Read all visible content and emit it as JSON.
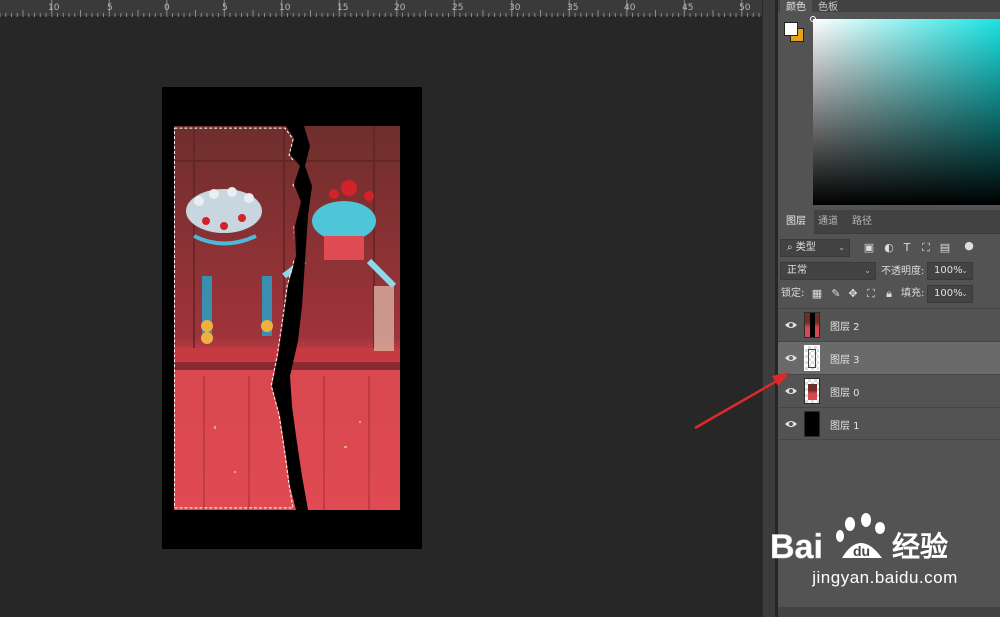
{
  "ruler": {
    "labels": [
      "10",
      "5",
      "0",
      "5",
      "10",
      "15",
      "20",
      "25",
      "30",
      "35",
      "40",
      "45",
      "50"
    ]
  },
  "color_panel": {
    "tabs": [
      "颜色",
      "色板"
    ],
    "foreground": "#ffffff",
    "background": "#e6a020"
  },
  "layers_panel": {
    "tabs": [
      "图层",
      "通道",
      "路径"
    ],
    "filter_kind": "类型",
    "blend_mode": "正常",
    "opacity_label": "不透明度:",
    "opacity_value": "100%",
    "lock_label": "锁定:",
    "fill_label": "填充:",
    "fill_value": "100%",
    "layers": [
      {
        "name": "图层 2",
        "selected": false
      },
      {
        "name": "图层 3",
        "selected": true
      },
      {
        "name": "图层 0",
        "selected": false
      },
      {
        "name": "图层 1",
        "selected": false
      }
    ]
  },
  "watermark": {
    "brand": "Bai du 经验",
    "url": "jingyan.baidu.com"
  }
}
